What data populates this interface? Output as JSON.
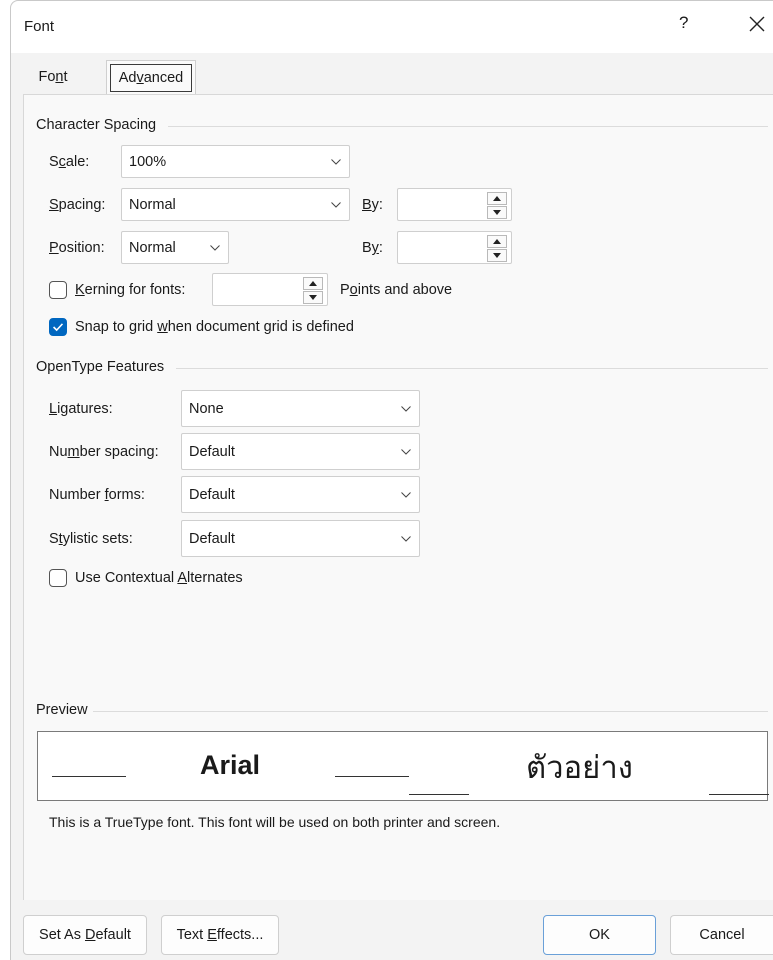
{
  "window": {
    "title": "Font",
    "help_label": "?"
  },
  "tabs": {
    "font": "Font",
    "advanced": "Advanced"
  },
  "character_spacing": {
    "heading": "Character Spacing",
    "scale": {
      "label": "Scale:",
      "value": "100%"
    },
    "spacing": {
      "label": "Spacing:",
      "value": "Normal",
      "by_label": "By:",
      "by_value": ""
    },
    "position": {
      "label": "Position:",
      "value": "Normal",
      "by_label": "By:",
      "by_value": ""
    },
    "kerning": {
      "label": "Kerning for fonts:",
      "checked": false,
      "value": "",
      "suffix": "Points and above"
    },
    "snap": {
      "label": "Snap to grid when document grid is defined",
      "checked": true
    }
  },
  "opentype": {
    "heading": "OpenType Features",
    "ligatures": {
      "label": "Ligatures:",
      "value": "None"
    },
    "number_spacing": {
      "label": "Number spacing:",
      "value": "Default"
    },
    "number_forms": {
      "label": "Number forms:",
      "value": "Default"
    },
    "stylistic_sets": {
      "label": "Stylistic sets:",
      "value": "Default"
    },
    "contextual": {
      "label": "Use Contextual Alternates",
      "checked": false
    }
  },
  "preview": {
    "heading": "Preview",
    "latin_sample": "Arial",
    "thai_sample": "ตัวอย่าง",
    "description": "This is a TrueType font. This font will be used on both printer and screen."
  },
  "buttons": {
    "set_default": "Set As Default",
    "text_effects": "Text Effects...",
    "ok": "OK",
    "cancel": "Cancel"
  },
  "icons": {
    "close": "close-icon",
    "chevron": "chevron-down-icon",
    "checkmark": "checkmark-icon"
  },
  "colors": {
    "accent": "#0067c0"
  }
}
